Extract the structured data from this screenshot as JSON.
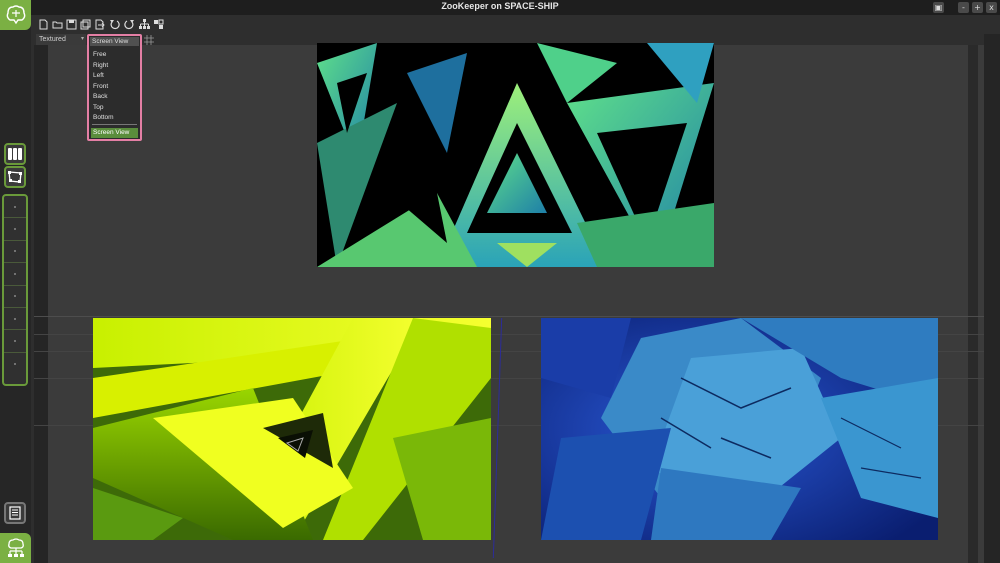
{
  "window": {
    "title": "ZooKeeper on SPACE-SHIP",
    "controls": [
      "▣",
      "-",
      "+",
      "x"
    ]
  },
  "toolbar": {
    "icons": [
      "new-file-icon",
      "open-folder-icon",
      "save-icon",
      "save-as-icon",
      "export-icon",
      "undo-icon",
      "redo-icon",
      "hierarchy-icon",
      "grid-icon"
    ],
    "render_mode": "Textured",
    "view_mode": "Screen View"
  },
  "view_dropdown": {
    "header": "Screen View",
    "options": [
      "Free",
      "Right",
      "Left",
      "Front",
      "Back",
      "Top",
      "Bottom"
    ],
    "selected": "Screen View"
  },
  "sidebar": {
    "logo_icon": "zoo-logo-icon",
    "slot_count": 8
  },
  "colors": {
    "accent_green": "#7bb043",
    "dropdown_border": "#e47fa5",
    "selected_item": "#5a8d3c"
  }
}
